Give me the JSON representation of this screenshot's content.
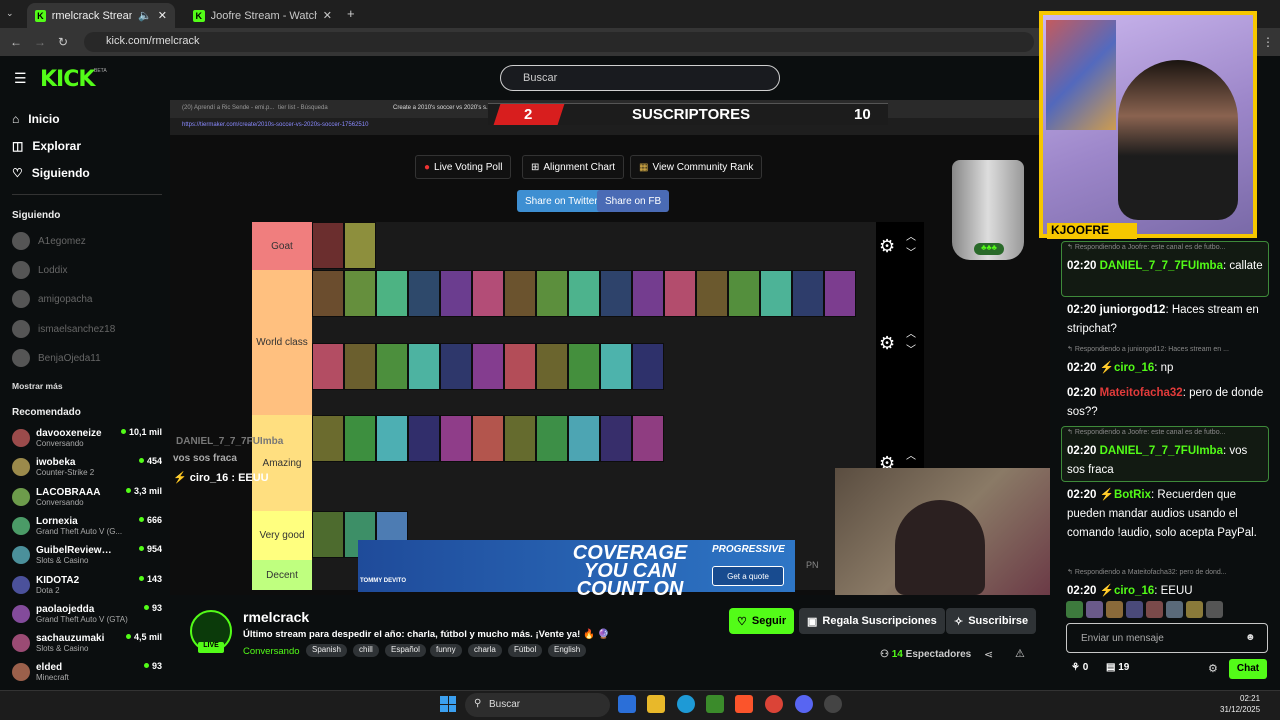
{
  "browser": {
    "tabs": [
      {
        "title": "rmelcrack Stream - Watch Li"
      },
      {
        "title": "Joofre Stream - Watch Live on l"
      }
    ],
    "url": "kick.com/rmelcrack"
  },
  "header": {
    "logo": "KICK",
    "beta": "BETA",
    "search_placeholder": "Buscar"
  },
  "sidebar": {
    "nav": [
      {
        "label": "Inicio",
        "icon": "home-icon"
      },
      {
        "label": "Explorar",
        "icon": "compass-icon"
      },
      {
        "label": "Siguiendo",
        "icon": "heart-icon"
      }
    ],
    "following_title": "Siguiendo",
    "following": [
      "A1egomez",
      "Loddix",
      "amigopacha",
      "ismaelsanchez18",
      "BenjaOjeda11"
    ],
    "show_more": "Mostrar más",
    "recommended_title": "Recomendado",
    "recommended": [
      {
        "name": "davooxeneize",
        "category": "Conversando",
        "viewers": "10,1 mil"
      },
      {
        "name": "iwobeka",
        "category": "Counter-Strike 2",
        "viewers": "454"
      },
      {
        "name": "LACOBRAAA",
        "category": "Conversando",
        "viewers": "3,3 mil"
      },
      {
        "name": "Lornexia",
        "category": "Grand Theft Auto V (G...",
        "viewers": "666"
      },
      {
        "name": "GuibelReviewsDir...",
        "category": "Slots & Casino",
        "viewers": "954"
      },
      {
        "name": "KIDOTA2",
        "category": "Dota 2",
        "viewers": "143"
      },
      {
        "name": "paolaojedda",
        "category": "Grand Theft Auto V (GTA)",
        "viewers": "93"
      },
      {
        "name": "sachauzumaki",
        "category": "Slots & Casino",
        "viewers": "4,5 mil"
      },
      {
        "name": "elded",
        "category": "Minecraft",
        "viewers": "93"
      }
    ]
  },
  "stream": {
    "inner_tabs": [
      "(20) Aprendí a Ric Sende - emi.p...",
      "tier list - Búsqueda",
      "Create a 2010's soccer vs 2020's s..."
    ],
    "inner_url": "https://tiermaker.com/create/2010s-soccer-vs-2020s-soccer-17562510",
    "sub_left": "2",
    "sub_label": "SUSCRIPTORES",
    "sub_right": "10",
    "toolbar": [
      "Live Voting Poll",
      "Alignment Chart",
      "View Community Rank"
    ],
    "share": [
      "Share on Twitter",
      "Share on FB"
    ],
    "tiers": [
      {
        "label": "Goat",
        "color": "#f07e7e"
      },
      {
        "label": "World class",
        "color": "#ffc07f"
      },
      {
        "label": "Amazing",
        "color": "#ffdf80"
      },
      {
        "label": "Very good",
        "color": "#ffff7f"
      },
      {
        "label": "Decent",
        "color": "#bfff7f"
      }
    ],
    "overlay_name": "DANIEL_7_7_7FUImba",
    "overlay_msg": "vos sos fraca",
    "overlay_msg2": "ciro_16 : EEUU",
    "ad_text": "COVERAGE YOU CAN COUNT ON",
    "ad_brand": "PROGRESSIVE",
    "ad_button": "Get a quote",
    "ad_pn": "PN",
    "ad_person": "TOMMY DEVITO",
    "cam_badge": "JOOFRE"
  },
  "info": {
    "name": "rmelcrack",
    "live": "LIVE",
    "title": "Último stream para despedir el año: charla, fútbol y mucho más. ¡Vente ya! 🔥 🔮",
    "category": "Conversando",
    "tags": [
      "Spanish",
      "chill",
      "Español",
      "funny",
      "charla",
      "Fútbol",
      "English"
    ],
    "follow": "Seguir",
    "gift": "Regala Suscripciones",
    "subscribe": "Suscribirse",
    "viewers": "14",
    "viewers_label": "Espectadores"
  },
  "chat": {
    "messages": [
      {
        "reply": "Respondiendo a Joofre: este canal es de futbo...",
        "time": "02:20",
        "user": "DANIEL_7_7_7FUImba",
        "color": "#53fc18",
        "text": "callate",
        "hl": true
      },
      {
        "time": "02:20",
        "user": "juniorgod12",
        "color": "#fff",
        "text": "Haces stream en stripchat?"
      },
      {
        "reply": "Respondiendo a juniorgod12: Haces stream en ...",
        "time": "02:20",
        "user": "ciro_16",
        "color": "#53fc18",
        "text": "np",
        "badge": true
      },
      {
        "time": "02:20",
        "user": "Mateitofacha32",
        "color": "#e23b3b",
        "text": "pero de donde sos??"
      },
      {
        "reply": "Respondiendo a Joofre: este canal es de futbo...",
        "time": "02:20",
        "user": "DANIEL_7_7_7FUImba",
        "color": "#53fc18",
        "text": "vos sos fraca",
        "hl": true
      },
      {
        "time": "02:20",
        "user": "BotRix",
        "color": "#53fc18",
        "text": "Recuerden que pueden mandar audios usando el comando !audio, solo acepta PayPal.",
        "badge": true
      },
      {
        "reply": "Respondiendo a Mateitofacha32: pero de dond...",
        "time": "02:20",
        "user": "ciro_16",
        "color": "#53fc18",
        "text": "EEUU",
        "badge": true
      }
    ],
    "input_placeholder": "Enviar un mensaje",
    "points": "0",
    "gifts": "19",
    "send": "Chat"
  },
  "taskbar": {
    "search": "Buscar",
    "time": "02:21",
    "date": "31/12/2025"
  }
}
